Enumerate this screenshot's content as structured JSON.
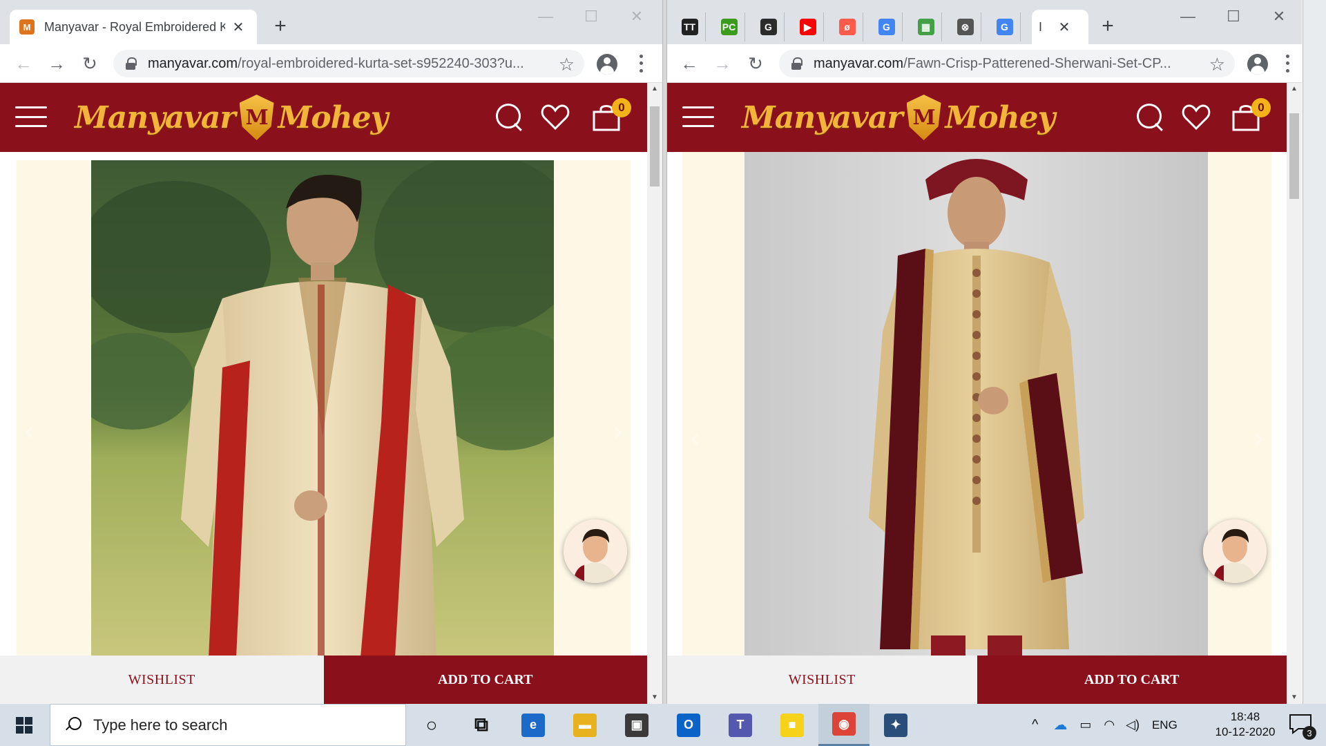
{
  "left_window": {
    "tab": {
      "favicon": "M",
      "title": "Manyavar - Royal Embroidered Kurta Set",
      "close": "✕"
    },
    "new_tab": "+",
    "controls": {
      "minimize": "—",
      "maximize": "☐",
      "close": "✕"
    },
    "url_host": "manyavar.com",
    "url_path": "/royal-embroidered-kurta-set-s952240-303?u...",
    "site": {
      "brand_left": "Manyavar",
      "brand_mark": "M",
      "brand_right": "Mohey",
      "cart_count": "0"
    },
    "buttons": {
      "wishlist": "WISHLIST",
      "add_to_cart": "ADD TO CART"
    }
  },
  "right_window": {
    "pinned_tabs": [
      {
        "icon": "TT",
        "color": "#222222",
        "name": "tab-tt"
      },
      {
        "icon": "PC",
        "color": "#3a9b1c",
        "name": "tab-pc"
      },
      {
        "icon": "G",
        "color": "#2b2b2b",
        "name": "tab-grammarly"
      },
      {
        "icon": "▶",
        "color": "#ff0000",
        "name": "tab-youtube"
      },
      {
        "icon": "ø",
        "color": "#ff5a4a",
        "name": "tab-blocked"
      },
      {
        "icon": "G",
        "color": "#4285f4",
        "name": "tab-google-1"
      },
      {
        "icon": "▦",
        "color": "#43a047",
        "name": "tab-sheet"
      },
      {
        "icon": "⊗",
        "color": "#555555",
        "name": "tab-circle"
      },
      {
        "icon": "G",
        "color": "#4285f4",
        "name": "tab-google-2"
      }
    ],
    "active_tab": {
      "title": "I",
      "close": "✕"
    },
    "new_tab": "+",
    "controls": {
      "minimize": "—",
      "maximize": "☐",
      "close": "✕"
    },
    "url_host": "manyavar.com",
    "url_path": "/Fawn-Crisp-Patterened-Sherwani-Set-CP...",
    "site": {
      "brand_left": "Manyavar",
      "brand_mark": "M",
      "brand_right": "Mohey",
      "cart_count": "0"
    },
    "buttons": {
      "wishlist": "WISHLIST",
      "add_to_cart": "ADD TO CART"
    }
  },
  "taskbar": {
    "search_placeholder": "Type here to search",
    "apps": [
      {
        "name": "cortana-icon",
        "glyph": "○",
        "color": "#111111"
      },
      {
        "name": "task-view-icon",
        "glyph": "⧉",
        "color": "#111111"
      },
      {
        "name": "edge-icon",
        "glyph": "e",
        "color": "#1b6ac9"
      },
      {
        "name": "file-explorer-icon",
        "glyph": "▬",
        "color": "#e8b21f"
      },
      {
        "name": "store-icon",
        "glyph": "▣",
        "color": "#3a3a3a"
      },
      {
        "name": "outlook-icon",
        "glyph": "O",
        "color": "#0a64c8"
      },
      {
        "name": "teams-icon",
        "glyph": "T",
        "color": "#5558af"
      },
      {
        "name": "sticky-notes-icon",
        "glyph": "■",
        "color": "#f7d21b"
      },
      {
        "name": "chrome-icon",
        "glyph": "◉",
        "color": "#db4437"
      },
      {
        "name": "app-icon",
        "glyph": "✦",
        "color": "#2a4e7a"
      }
    ],
    "tray": {
      "language": "ENG",
      "time": "18:48",
      "date": "10-12-2020",
      "notifications": "3"
    }
  },
  "colors": {
    "brand_maroon": "#8a101c",
    "brand_gold": "#f3b43a",
    "badge_yellow": "#f4b318"
  }
}
